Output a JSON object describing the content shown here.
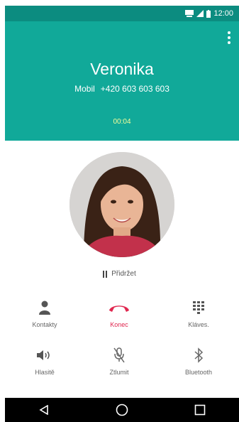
{
  "status": {
    "time": "12:00"
  },
  "call": {
    "name": "Veronika",
    "number_label": "Mobil",
    "number": "+420 603 603 603",
    "duration": "00:04"
  },
  "hold_label": "Přidržet",
  "actions": [
    {
      "id": "contacts",
      "label": "Kontakty",
      "icon": "person-icon"
    },
    {
      "id": "end",
      "label": "Konec",
      "icon": "end-call-icon",
      "color": "#e0274f"
    },
    {
      "id": "keypad",
      "label": "Kláves.",
      "icon": "dialpad-icon"
    },
    {
      "id": "speaker",
      "label": "Hlasitě",
      "icon": "speaker-icon"
    },
    {
      "id": "mute",
      "label": "Ztlumit",
      "icon": "mute-mic-icon"
    },
    {
      "id": "bluetooth",
      "label": "Bluetooth",
      "icon": "bluetooth-icon"
    }
  ],
  "colors": {
    "header": "#11a999",
    "status_bar": "#0c8c80",
    "end_call": "#e0274f",
    "timer": "#f5ff9a"
  }
}
